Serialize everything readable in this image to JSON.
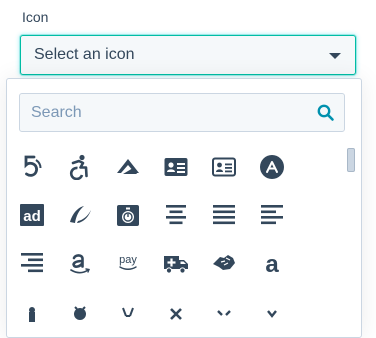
{
  "field": {
    "label": "Icon",
    "select_value": "Select an icon"
  },
  "dropdown": {
    "search_placeholder": "Search",
    "icons": [
      "500px-icon",
      "accessible-icon",
      "accusoft-icon",
      "address-card-icon",
      "address-card-outline-icon",
      "app-store-circle-icon",
      "adversal-icon",
      "affiliatetheme-icon",
      "stopwatch-icon",
      "align-center-icon",
      "align-justify-icon",
      "align-left-icon",
      "align-right-icon",
      "amazon-icon",
      "amazon-pay-icon",
      "ambulance-icon",
      "american-sign-language-icon",
      "amilia-icon",
      "partial-icon-1",
      "partial-icon-2",
      "partial-icon-3",
      "partial-icon-4",
      "partial-icon-5",
      "partial-icon-6"
    ],
    "icon_texts": {
      "adversal": "ad",
      "amazon_pay": "pay",
      "amilia": "a"
    }
  },
  "colors": {
    "accent": "#00bda5",
    "text": "#33475b",
    "placeholder": "#7c98b6",
    "search_icon": "#0091ae"
  }
}
